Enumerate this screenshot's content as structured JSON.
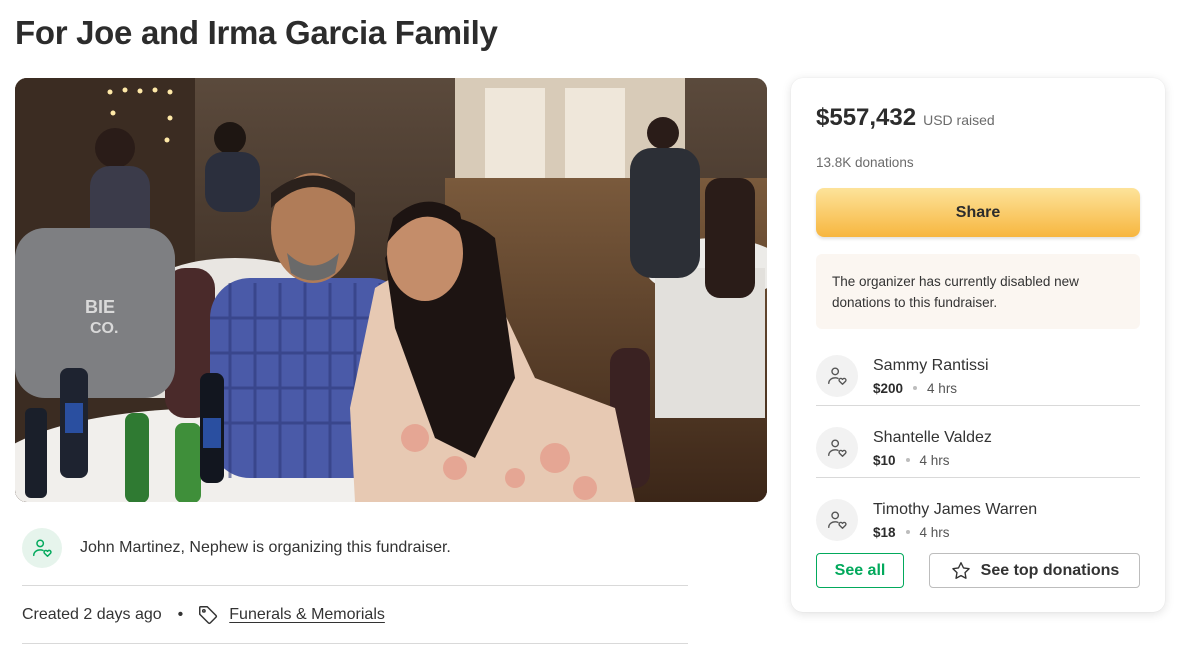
{
  "page": {
    "title": "For Joe and Irma Garcia Family"
  },
  "organizer": {
    "text": "John Martinez, Nephew is organizing this fundraiser.",
    "icon": "user-heart-icon"
  },
  "meta": {
    "created": "Created 2 days ago",
    "separator": "•",
    "category": "Funerals & Memorials",
    "category_icon": "tag-icon"
  },
  "card": {
    "amount": "$557,432",
    "raised_label": "USD raised",
    "donations_count": "13.8K donations",
    "share_label": "Share",
    "notice": "The organizer has currently disabled new donations to this fundraiser.",
    "donors": [
      {
        "name": "Sammy Rantissi",
        "amount": "$200",
        "time": "4 hrs"
      },
      {
        "name": "Shantelle Valdez",
        "amount": "$10",
        "time": "4 hrs"
      },
      {
        "name": "Timothy James Warren",
        "amount": "$18",
        "time": "4 hrs"
      }
    ],
    "see_all_label": "See all",
    "see_top_label": "See top donations"
  },
  "colors": {
    "brand_green": "#02a95c",
    "share_gradient_top": "#fde39a",
    "share_gradient_bottom": "#f7b63f",
    "notice_bg": "#fbf6f1"
  }
}
